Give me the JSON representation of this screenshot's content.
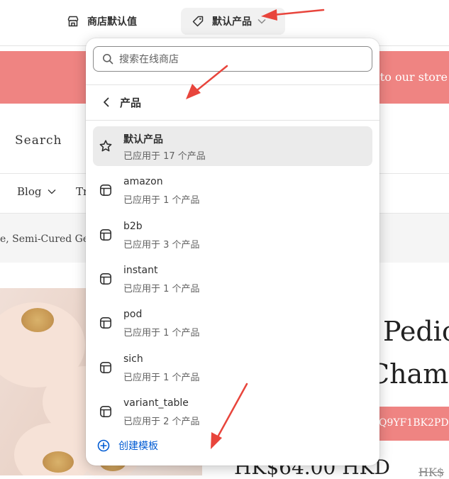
{
  "topbar": {
    "store_defaults_label": "商店默认值",
    "product_label": "默认产品"
  },
  "storefront": {
    "banner_text": "e to our store",
    "search_label": "Search",
    "nav_blog": "Blog",
    "nav_tr": "Tr",
    "breadcrumb_text": "e, Semi-Cured Ge",
    "title_line1": "Pedic",
    "title_line2": "Champ",
    "code": "Q9YF1BK2PD",
    "price": "HK$64.00 HKD",
    "price_old": "HK$"
  },
  "dropdown": {
    "search_placeholder": "搜索在线商店",
    "back_label": "产品",
    "items": [
      {
        "name": "默认产品",
        "sub": "已应用于 17 个产品",
        "icon": "star-icon",
        "selected": true
      },
      {
        "name": "amazon",
        "sub": "已应用于 1 个产品",
        "icon": "template-icon"
      },
      {
        "name": "b2b",
        "sub": "已应用于 3 个产品",
        "icon": "template-icon"
      },
      {
        "name": "instant",
        "sub": "已应用于 1 个产品",
        "icon": "template-icon"
      },
      {
        "name": "pod",
        "sub": "已应用于 1 个产品",
        "icon": "template-icon"
      },
      {
        "name": "sich",
        "sub": "已应用于 1 个产品",
        "icon": "template-icon"
      },
      {
        "name": "variant_table",
        "sub": "已应用于 2 个产品",
        "icon": "template-icon"
      }
    ],
    "create_label": "创建模板"
  },
  "colors": {
    "banner": "#ef8482",
    "link": "#005bd3",
    "arrow": "#e8453c",
    "selected_bg": "#ebebeb"
  }
}
